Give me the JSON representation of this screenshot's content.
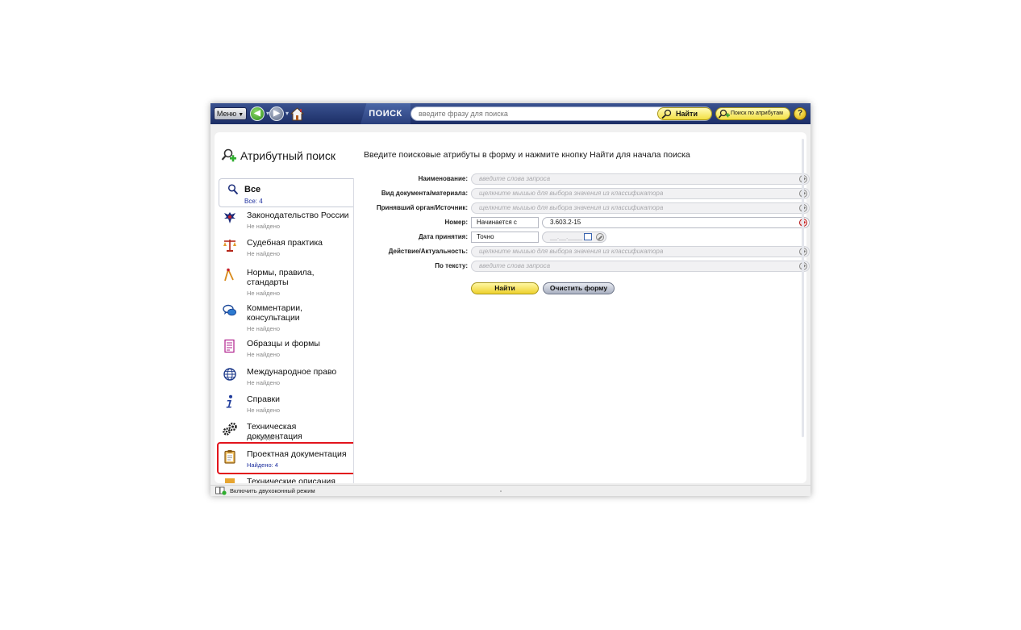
{
  "toolbar": {
    "menu_label": "Меню",
    "search_label": "ПОИСК",
    "search_placeholder": "введите фразу для поиска",
    "find_label": "Найти",
    "attr_search_label": "Поиск по атрибутам",
    "help_label": "?"
  },
  "sidebar": {
    "title": "Атрибутный поиск",
    "all": {
      "label": "Все",
      "count": "Все: 4"
    },
    "items": [
      {
        "label": "Законодательство России",
        "status": "Не найдено",
        "icon": "eagle-icon"
      },
      {
        "label": "Судебная практика",
        "status": "Не найдено",
        "icon": "scales-icon"
      },
      {
        "label": "Нормы, правила, стандарты",
        "status": "Не найдено",
        "icon": "compass-icon"
      },
      {
        "label": "Комментарии, консультации",
        "status": "Не найдено",
        "icon": "speech-bubbles-icon"
      },
      {
        "label": "Образцы и формы",
        "status": "Не найдено",
        "icon": "form-doc-icon"
      },
      {
        "label": "Международное право",
        "status": "Не найдено",
        "icon": "globe-icon"
      },
      {
        "label": "Справки",
        "status": "Не найдено",
        "icon": "info-icon"
      },
      {
        "label": "Техническая документация",
        "status": "Не найдено",
        "icon": "gears-icon"
      },
      {
        "label": "Проектная документация",
        "status": "Найдено: 4",
        "icon": "clipboard-icon"
      },
      {
        "label": "Технические описания",
        "status": "",
        "icon": "tech-desc-icon"
      }
    ]
  },
  "form": {
    "intro": "Введите поисковые атрибуты в форму и нажмите кнопку Найти для начала поиска",
    "name": {
      "label": "Наименование:",
      "placeholder": "введите слова запроса"
    },
    "doctype": {
      "label": "Вид документа/материала:",
      "placeholder": "щелкните мышью для выбора значения из классификатора"
    },
    "issuer": {
      "label": "Принявший орган/Источник:",
      "placeholder": "щелкните мышью для выбора значения из классификатора"
    },
    "number": {
      "label": "Номер:",
      "mode": "Начинается с",
      "value": "3.603.2-15"
    },
    "date": {
      "label": "Дата принятия:",
      "mode": "Точно",
      "value": "__.__.____"
    },
    "status": {
      "label": "Действие/Актуальность:",
      "placeholder": "щелкните мышью для выбора значения из классификатора"
    },
    "text": {
      "label": "По тексту:",
      "placeholder": "введите слова запроса"
    },
    "find_button": "Найти",
    "clear_button": "Очистить форму"
  },
  "statusbar": {
    "dual_window_label": "Включить двухоконный режим"
  },
  "colors": {
    "toolbar": "#1c2e66",
    "accent_yellow": "#f2df43",
    "highlight_red": "#e2141c",
    "found_blue": "#1c2e9e"
  }
}
